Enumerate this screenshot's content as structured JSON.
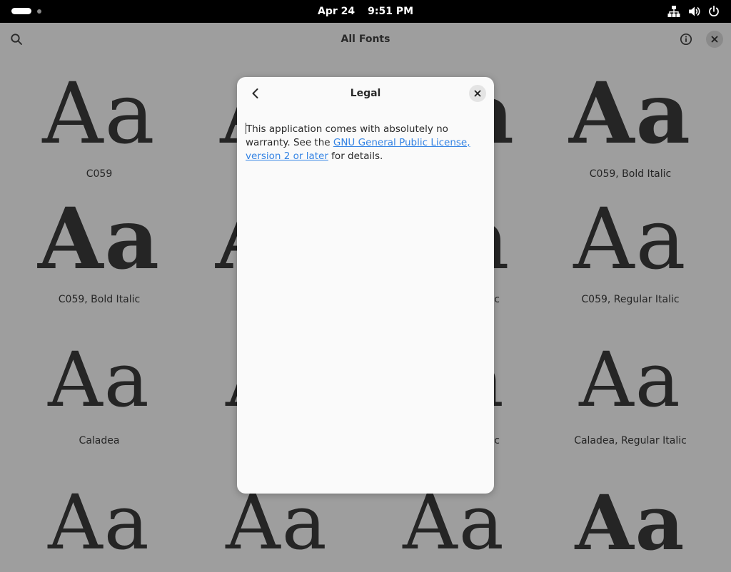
{
  "topbar": {
    "date": "Apr 24",
    "time": "9:51 PM",
    "icons": [
      "activities-pill",
      "network-icon",
      "volume-icon",
      "power-icon"
    ]
  },
  "app": {
    "title": "All Fonts",
    "icons": [
      "search-icon",
      "info-icon",
      "close-icon"
    ]
  },
  "fonts": [
    {
      "sample": "Aa",
      "label": "C059"
    },
    {
      "sample": "Aa",
      "label": ""
    },
    {
      "sample": "Aa",
      "label": ""
    },
    {
      "sample": "Aa",
      "label": "C059, Bold Italic"
    },
    {
      "sample": "Aa",
      "label": "C059, Bold Italic"
    },
    {
      "sample": "Aa",
      "label": ""
    },
    {
      "sample": "Aa",
      "label": "c"
    },
    {
      "sample": "Aa",
      "label": "C059, Regular Italic"
    },
    {
      "sample": "Aa",
      "label": "Caladea"
    },
    {
      "sample": "Aa",
      "label": ""
    },
    {
      "sample": "Aa",
      "label": "c"
    },
    {
      "sample": "Aa",
      "label": "Caladea, Regular Italic"
    },
    {
      "sample": "Aa",
      "label": ""
    },
    {
      "sample": "Aa",
      "label": ""
    },
    {
      "sample": "Aa",
      "label": ""
    },
    {
      "sample": "Aa",
      "label": ""
    }
  ],
  "dialog": {
    "title": "Legal",
    "text_1": "This application comes with absolutely no warranty. See the ",
    "link": "GNU General Public License, version 2 or later",
    "text_2": " for details."
  }
}
